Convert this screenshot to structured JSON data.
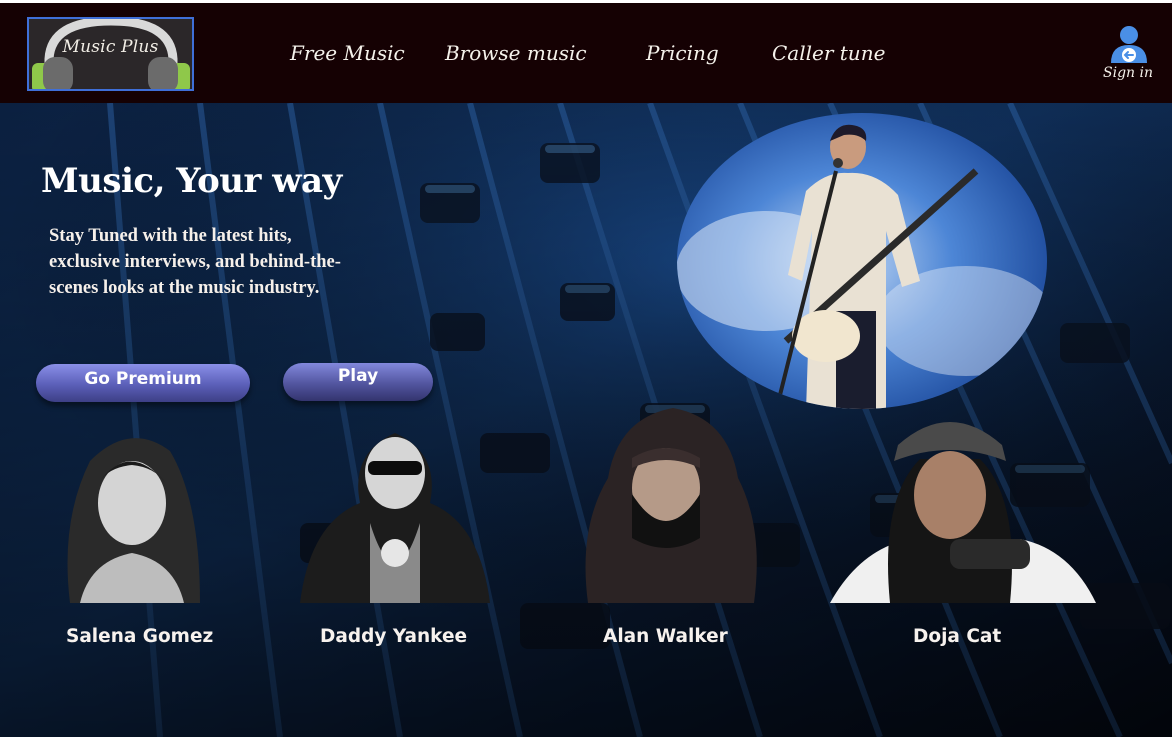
{
  "header": {
    "logo_text": "Music Plus",
    "nav": [
      {
        "label": "Free Music"
      },
      {
        "label": "Browse music"
      },
      {
        "label": "Pricing"
      },
      {
        "label": "Caller tune"
      }
    ],
    "signin_label": "Sign in"
  },
  "hero": {
    "title": "Music, Your way",
    "subtitle": "Stay Tuned with the latest hits, exclusive interviews, and behind-the-scenes looks at the music industry.",
    "buttons": {
      "premium": "Go Premium",
      "play": "Play"
    }
  },
  "artists": [
    {
      "name": "Salena Gomez"
    },
    {
      "name": "Daddy Yankee"
    },
    {
      "name": "Alan Walker"
    },
    {
      "name": "Doja Cat"
    }
  ],
  "colors": {
    "header_bg": "#150103",
    "logo_border": "#3f6fd8",
    "button": "#5b5fb8",
    "signin_icon": "#4a8fe6"
  },
  "icons": {
    "logo": "headphones-icon",
    "signin": "user-signin-icon"
  }
}
